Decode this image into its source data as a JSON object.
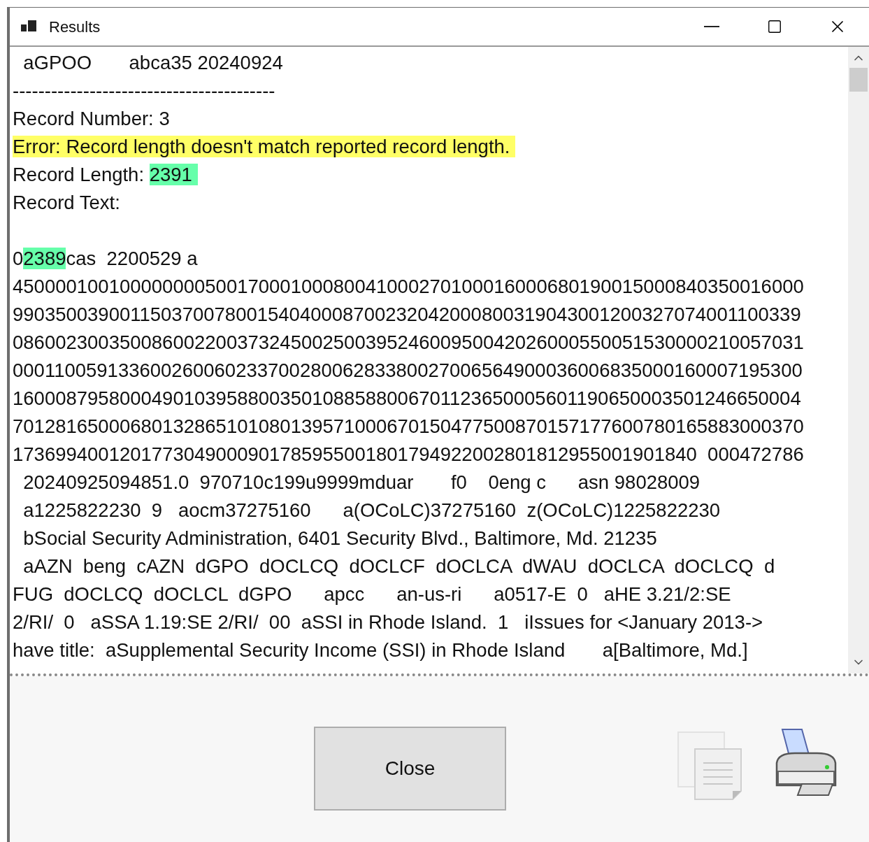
{
  "window": {
    "title": "Results"
  },
  "lines": [
    {
      "segments": [
        {
          "text": "  aGPOO       abca35 20240924"
        }
      ]
    },
    {
      "segments": [
        {
          "text": "-----------------------------------------"
        }
      ]
    },
    {
      "segments": [
        {
          "text": "Record Number: 3"
        }
      ]
    },
    {
      "segments": [
        {
          "text": "Error: Record length doesn't match reported record length. ",
          "color": "#ffff66"
        }
      ]
    },
    {
      "segments": [
        {
          "text": "Record Length: "
        },
        {
          "text": "2391 ",
          "color": "#66ffaa"
        }
      ]
    },
    {
      "segments": [
        {
          "text": "Record Text:"
        }
      ]
    },
    {
      "blank_before": true,
      "segments": [
        {
          "text": "0"
        },
        {
          "text": "2389",
          "color": "#66ffaa"
        },
        {
          "text": "cas  2200529 a"
        }
      ]
    },
    {
      "segments": [
        {
          "text": "45000010010000000050017000100080041000270100016000680190015000840350016000"
        }
      ]
    },
    {
      "segments": [
        {
          "text": "99035003900115037007800154040008700232042000800319043001200327074001100339"
        }
      ]
    },
    {
      "segments": [
        {
          "text": "08600230035008600220037324500250039524600950042026000550051530000210057031"
        }
      ]
    },
    {
      "segments": [
        {
          "text": "00011005913360026006023370028006283380027006564900036006835000160007195300"
        }
      ]
    },
    {
      "segments": [
        {
          "text": "16000879580004901039588003501088588006701123650005601190650003501246650004"
        }
      ]
    },
    {
      "segments": [
        {
          "text": "70128165000680132865101080139571000670150477500870157177600780165883000370"
        }
      ]
    },
    {
      "segments": [
        {
          "text": "1736994001201773049000901785955001801794922002801812955001901840  000472786"
        }
      ]
    },
    {
      "segments": [
        {
          "text": "  20240925094851.0  970710c199u9999mduar       f0    0eng c      asn 98028009"
        }
      ]
    },
    {
      "segments": [
        {
          "text": "  a1225822230  9   aocm37275160      a(OCoLC)37275160  z(OCoLC)1225822230"
        }
      ]
    },
    {
      "segments": [
        {
          "text": "  bSocial Security Administration, 6401 Security Blvd., Baltimore, Md. 21235"
        }
      ]
    },
    {
      "segments": [
        {
          "text": "  aAZN  beng  cAZN  dGPO  dOCLCQ  dOCLCF  dOCLCA  dWAU  dOCLCA  dOCLCQ  d"
        }
      ]
    },
    {
      "segments": [
        {
          "text": "FUG  dOCLCQ  dOCLCL  dGPO      apcc      an-us-ri      a0517-E  0   aHE 3.21/2:SE"
        }
      ]
    },
    {
      "segments": [
        {
          "text": "2/RI/  0   aSSA 1.19:SE 2/RI/  00  aSSI in Rhode Island.  1   iIssues for <January 2013->"
        }
      ]
    },
    {
      "segments": [
        {
          "text": "have title:  aSupplemental Security Income (SSI) in Rhode Island       a[Baltimore, Md.]"
        }
      ]
    }
  ],
  "buttons": {
    "close": "Close"
  }
}
